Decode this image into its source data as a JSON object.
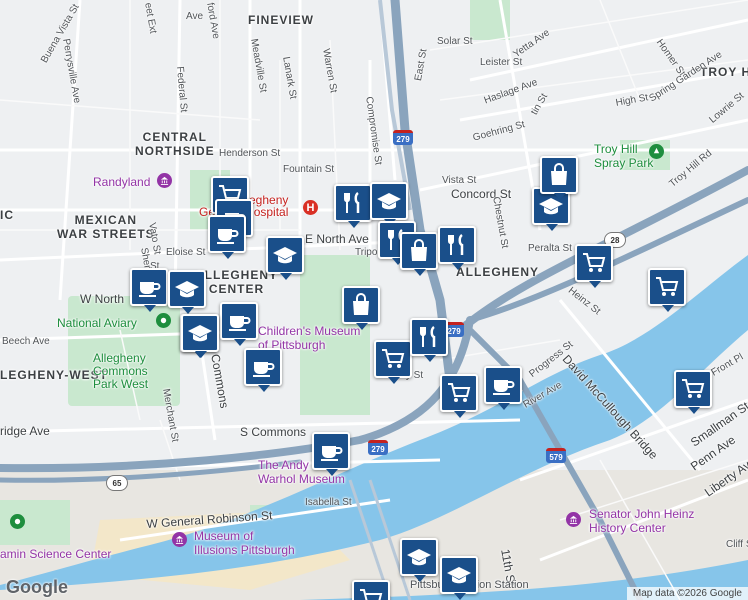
{
  "map": {
    "neighborhoods": [
      {
        "id": "fineview",
        "text": "FINEVIEW"
      },
      {
        "id": "central-northside",
        "text": "CENTRAL\nNORTHSIDE"
      },
      {
        "id": "mexican-war-streets",
        "text": "MEXICAN\nWAR STREETS"
      },
      {
        "id": "allegheny-center",
        "text": "ALLEGHENY\nCENTER"
      },
      {
        "id": "allegheny-west",
        "text": "LEGHENY-WEST"
      },
      {
        "id": "allegheny-east",
        "text": "ALLEGHENY"
      },
      {
        "id": "troy-hill",
        "text": "TROY HILL"
      },
      {
        "id": "ic",
        "text": "IC"
      }
    ],
    "streets": [
      "eet Ext",
      "ford Ave",
      "Perrysville Ave",
      "Federal St",
      "Buena Vista St",
      "Meadville St",
      "Lanark St",
      "Warren St",
      "Compromise St",
      "East St",
      "Solar St",
      "Leister St",
      "Yetta Ave",
      "Haslage Ave",
      "Homer St",
      "Spring Garden Ave",
      "Lowrie St",
      "High St",
      "Goehring St",
      "tin St",
      "Henderson St",
      "Fountain St",
      "Vista St",
      "Concord St",
      "Troy Hill Rd",
      "Vato St",
      "Sherman Av",
      "Eloise St",
      "E North Ave",
      "Tripoli",
      "Chestnut St",
      "Peralta St",
      "W North",
      "Beech Ave",
      "Heinz St",
      "Commons",
      "Merchant St",
      "ridge Ave",
      "S Commons",
      "Progress St",
      "River Ave",
      "David McCullough Bridge",
      "Smallman St",
      "Penn Ave",
      "Liberty Av",
      "W General Robinson St",
      "Isabella St",
      "11th St",
      "Cliff S",
      "Front Pl",
      "Pre    ey St",
      "St",
      "Ave"
    ],
    "places": [
      {
        "id": "randyland",
        "text": "Randyland"
      },
      {
        "id": "hospital",
        "text": "Allegheny\nGeneral Hospital"
      },
      {
        "id": "national-aviary",
        "text": "National Aviary"
      },
      {
        "id": "commons-park",
        "text": "Allegheny\nCommons\nPark West"
      },
      {
        "id": "childrens-museum",
        "text": "Children's Museum\nof Pittsburgh"
      },
      {
        "id": "warhol",
        "text": "The Andy\nWarhol Museum"
      },
      {
        "id": "illusions",
        "text": "Museum of\nIllusions Pittsburgh"
      },
      {
        "id": "science-center",
        "text": "amin Science Center"
      },
      {
        "id": "troy-hill-park",
        "text": "Troy Hill\nSpray Park"
      },
      {
        "id": "heinz-history",
        "text": "Senator John Heinz\nHistory Center"
      },
      {
        "id": "union-station",
        "text": "Pittsburgh Union Station"
      }
    ],
    "shields": {
      "i279a": "279",
      "i279b": "279",
      "i279c": "279",
      "i579": "579",
      "r65": "65",
      "r28": "28"
    },
    "markers": [
      {
        "icon": "shopping-cart"
      },
      {
        "icon": "coffee-cup"
      },
      {
        "icon": "coffee-cup"
      },
      {
        "icon": "graduation-cap"
      },
      {
        "icon": "restaurant"
      },
      {
        "icon": "graduation-cap"
      },
      {
        "icon": "graduation-cap"
      },
      {
        "icon": "coffee-cup"
      },
      {
        "icon": "graduation-cap"
      },
      {
        "icon": "coffee-cup"
      },
      {
        "icon": "coffee-cup"
      },
      {
        "icon": "coffee-cup"
      },
      {
        "icon": "shopping-bag"
      },
      {
        "icon": "restaurant"
      },
      {
        "icon": "shopping-bag"
      },
      {
        "icon": "restaurant"
      },
      {
        "icon": "shopping-cart"
      },
      {
        "icon": "restaurant"
      },
      {
        "icon": "shopping-cart"
      },
      {
        "icon": "coffee-cup"
      },
      {
        "icon": "shopping-bag"
      },
      {
        "icon": "graduation-cap"
      },
      {
        "icon": "shopping-cart"
      },
      {
        "icon": "shopping-cart"
      },
      {
        "icon": "shopping-cart"
      },
      {
        "icon": "coffee-cup"
      },
      {
        "icon": "graduation-cap"
      },
      {
        "icon": "graduation-cap"
      },
      {
        "icon": "shopping-cart"
      }
    ],
    "attribution": "Map data ©2026 Google",
    "logo": "Google",
    "colors": {
      "marker": "#1a4f8a",
      "water": "#86c5ea",
      "park": "#c9e8cf",
      "highway": "#8aa4bd",
      "interstate_shield": "#3a6fc4"
    }
  }
}
